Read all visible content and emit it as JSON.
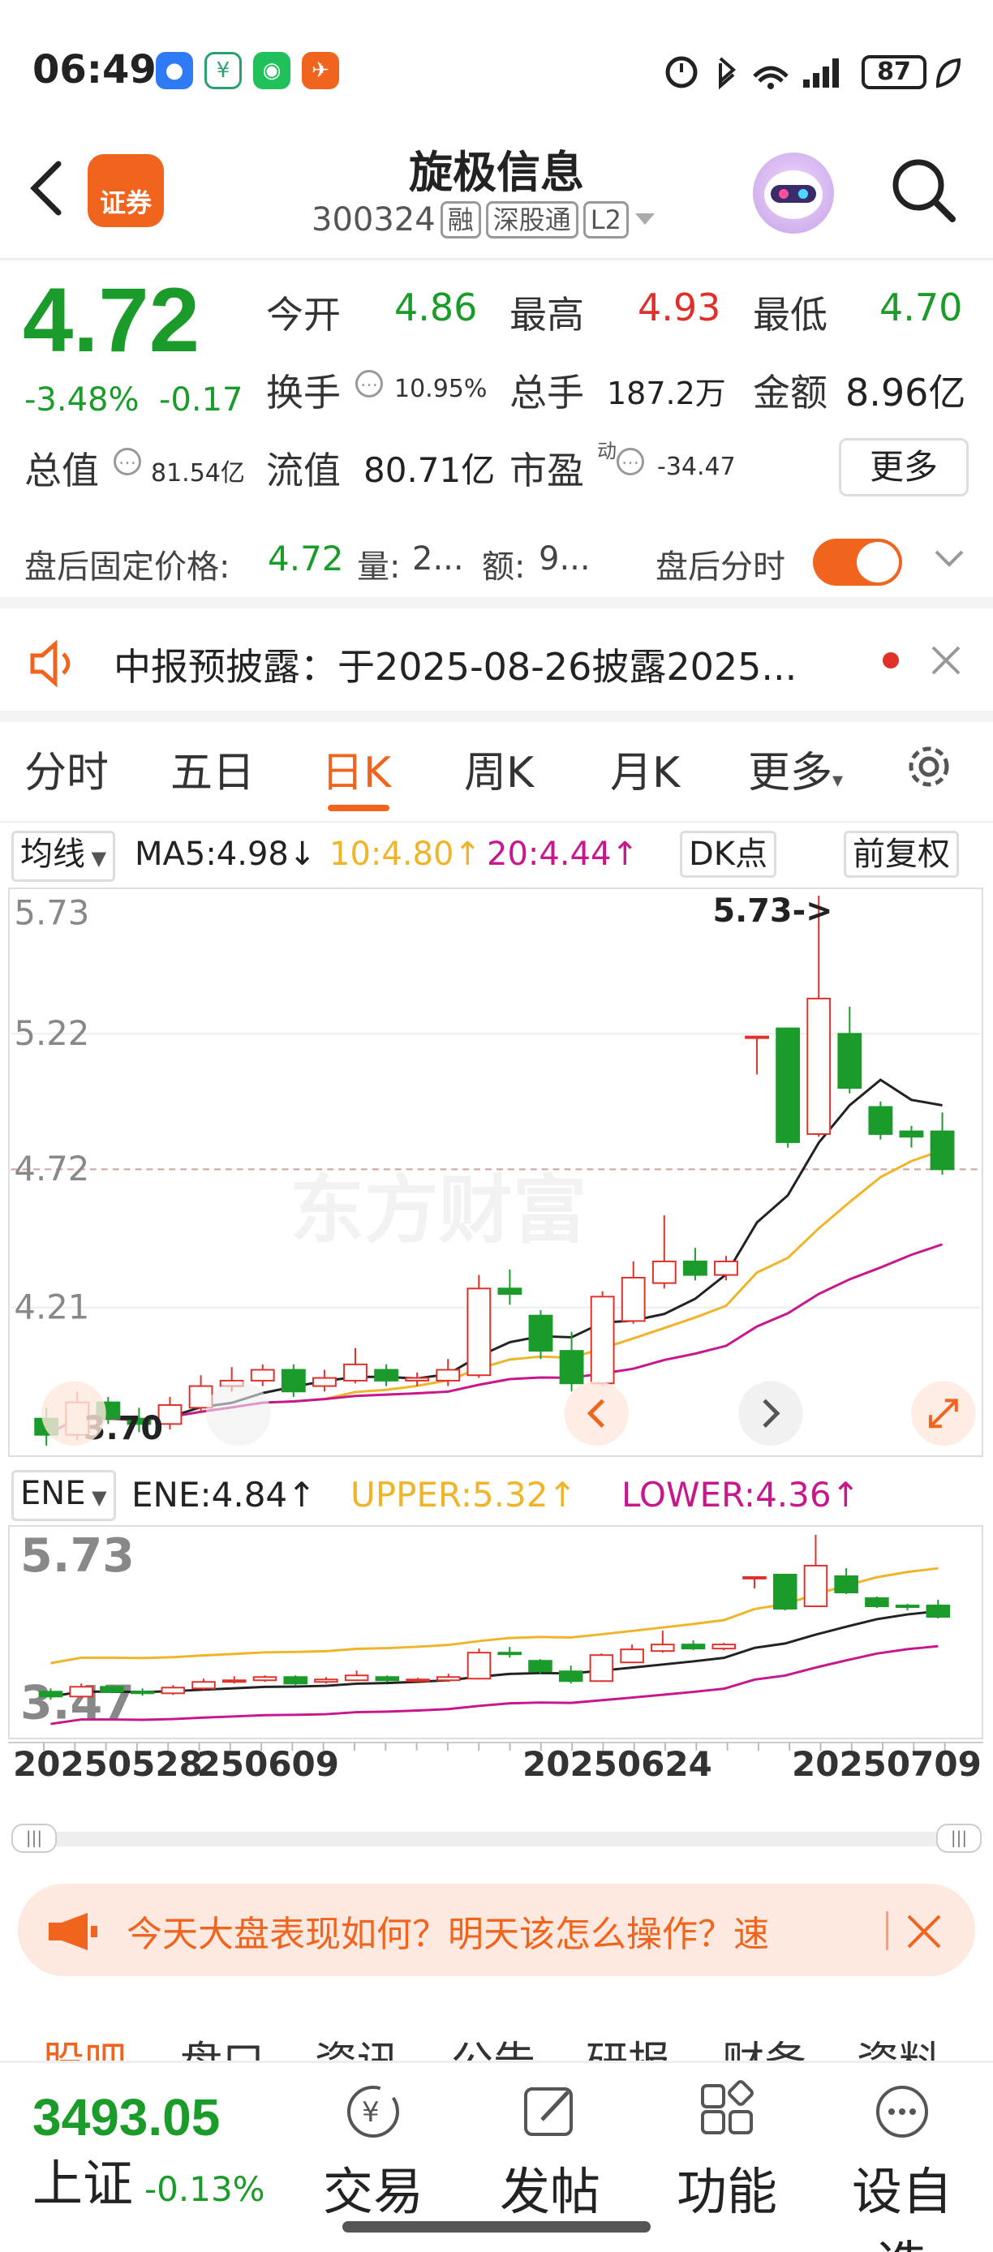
{
  "status_bar": {
    "time": "06:49",
    "battery": "87"
  },
  "header": {
    "back_label": "<",
    "logo_text": "证券",
    "stock_name": "旋极信息",
    "stock_code": "300324",
    "tags": [
      "融",
      "深股通",
      "L2"
    ]
  },
  "quote": {
    "price": "4.72",
    "change_pct": "-3.48%",
    "change_amt": "-0.17",
    "open_label": "今开",
    "open_value": "4.86",
    "high_label": "最高",
    "high_value": "4.93",
    "low_label": "最低",
    "low_value": "4.70",
    "turnover_label": "换手",
    "turnover_value": "10.95%",
    "volume_label": "总手",
    "volume_value": "187.2万",
    "amount_label": "金额",
    "amount_value": "8.96亿",
    "total_mv_label": "总值",
    "total_mv_value": "81.54亿",
    "float_mv_label": "流值",
    "float_mv_value": "80.71亿",
    "pe_label": "市盈",
    "pe_sup": "动",
    "pe_value": "-34.47",
    "more_button": "更多"
  },
  "after_hours": {
    "price_label": "盘后固定价格:",
    "price_value": "4.72",
    "vol_label": "量:",
    "vol_value": "2...",
    "amt_label": "额:",
    "amt_value": "9...",
    "intraday_label": "盘后分时"
  },
  "notice": {
    "text": "中报预披露：于2025-08-26披露2025..."
  },
  "tabs": [
    "分时",
    "五日",
    "日K",
    "周K",
    "月K",
    "更多"
  ],
  "ma_bar": {
    "selector": "均线",
    "ma5": "MA5:4.98↓",
    "ma10": "10:4.80↑",
    "ma20": "20:4.44↑",
    "dk_label": "DK点",
    "adjust_label": "前复权"
  },
  "main_axis": {
    "y_labels": [
      "5.73",
      "5.22",
      "4.72",
      "4.21",
      "3.70"
    ],
    "max_marker": "5.73->",
    "watermark": "东方财富"
  },
  "indicator_bar": {
    "selector": "ENE",
    "ene": "ENE:4.84↑",
    "upper": "UPPER:5.32↑",
    "lower": "LOWER:4.36↑"
  },
  "sub_axis": {
    "y_labels": [
      "5.73",
      "3.47"
    ]
  },
  "dates": [
    "20250528",
    "20250609",
    "20250624",
    "20250709"
  ],
  "banner": {
    "text": "今天大盘表现如何？明天该怎么操作？速"
  },
  "bottom_tabs": [
    "股吧",
    "盘口",
    "资讯",
    "公告",
    "研报",
    "财务",
    "资料"
  ],
  "bottom_bar": {
    "index_value": "3493.05",
    "index_name": "上证",
    "index_change": "-0.13%",
    "items": [
      "交易",
      "发帖",
      "功能",
      "设自选"
    ]
  },
  "colors": {
    "up": "#e0302a",
    "down": "#1a9b2a",
    "accent": "#f0641e",
    "ma5": "#222222",
    "ma10": "#f0b429",
    "ma20": "#c8168c"
  },
  "chart_data": {
    "type": "candlestick",
    "ylim": [
      3.7,
      5.73
    ],
    "candles": [
      {
        "o": 3.8,
        "c": 3.74,
        "h": 3.84,
        "l": 3.7
      },
      {
        "o": 3.74,
        "c": 3.86,
        "h": 3.9,
        "l": 3.72
      },
      {
        "o": 3.86,
        "c": 3.8,
        "h": 3.88,
        "l": 3.78
      },
      {
        "o": 3.8,
        "c": 3.78,
        "h": 3.84,
        "l": 3.75
      },
      {
        "o": 3.78,
        "c": 3.85,
        "h": 3.88,
        "l": 3.76
      },
      {
        "o": 3.84,
        "c": 3.92,
        "h": 3.96,
        "l": 3.82
      },
      {
        "o": 3.92,
        "c": 3.94,
        "h": 3.99,
        "l": 3.9
      },
      {
        "o": 3.94,
        "c": 3.98,
        "h": 4.0,
        "l": 3.92
      },
      {
        "o": 3.98,
        "c": 3.9,
        "h": 4.0,
        "l": 3.88
      },
      {
        "o": 3.92,
        "c": 3.95,
        "h": 3.98,
        "l": 3.9
      },
      {
        "o": 3.94,
        "c": 4.0,
        "h": 4.06,
        "l": 3.93
      },
      {
        "o": 3.98,
        "c": 3.94,
        "h": 4.0,
        "l": 3.92
      },
      {
        "o": 3.94,
        "c": 3.95,
        "h": 3.97,
        "l": 3.92
      },
      {
        "o": 3.94,
        "c": 3.98,
        "h": 4.02,
        "l": 3.92
      },
      {
        "o": 3.96,
        "c": 4.28,
        "h": 4.33,
        "l": 3.95
      },
      {
        "o": 4.28,
        "c": 4.26,
        "h": 4.35,
        "l": 4.22
      },
      {
        "o": 4.18,
        "c": 4.05,
        "h": 4.2,
        "l": 4.02
      },
      {
        "o": 4.05,
        "c": 3.93,
        "h": 4.12,
        "l": 3.9
      },
      {
        "o": 3.93,
        "c": 4.25,
        "h": 4.27,
        "l": 3.92
      },
      {
        "o": 4.16,
        "c": 4.32,
        "h": 4.38,
        "l": 4.15
      },
      {
        "o": 4.3,
        "c": 4.38,
        "h": 4.55,
        "l": 4.28
      },
      {
        "o": 4.38,
        "c": 4.33,
        "h": 4.43,
        "l": 4.31
      },
      {
        "o": 4.33,
        "c": 4.38,
        "h": 4.4,
        "l": 4.31
      },
      {
        "o": 5.21,
        "c": 5.21,
        "h": 5.21,
        "l": 5.07
      },
      {
        "o": 5.24,
        "c": 4.82,
        "h": 5.24,
        "l": 4.8
      },
      {
        "o": 4.85,
        "c": 5.35,
        "h": 5.73,
        "l": 4.84
      },
      {
        "o": 5.22,
        "c": 5.02,
        "h": 5.32,
        "l": 5.0
      },
      {
        "o": 4.95,
        "c": 4.85,
        "h": 4.97,
        "l": 4.83
      },
      {
        "o": 4.86,
        "c": 4.84,
        "h": 4.88,
        "l": 4.8
      },
      {
        "o": 4.86,
        "c": 4.72,
        "h": 4.93,
        "l": 4.7
      }
    ]
  }
}
